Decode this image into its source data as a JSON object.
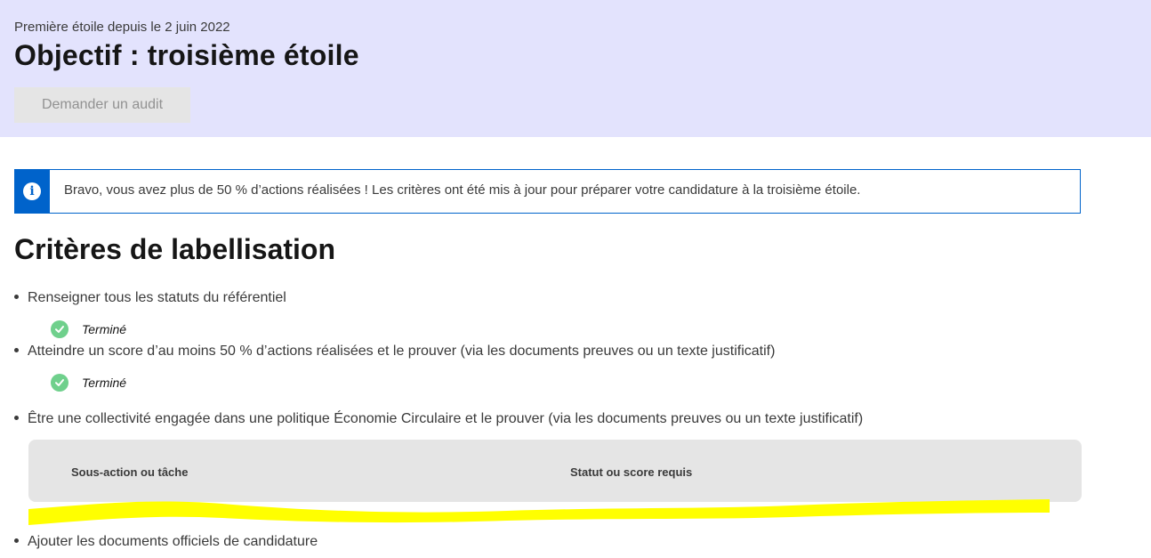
{
  "header": {
    "subtitle": "Première étoile depuis le 2 juin 2022",
    "title": "Objectif : troisième étoile",
    "audit_button_label": "Demander un audit",
    "background_color": "#e3e3fd"
  },
  "alert": {
    "icon": "info-icon",
    "icon_glyph": "i",
    "message": "Bravo, vous avez plus de 50 % d’actions réalisées ! Les critères ont été mis à jour pour préparer votre candidature à la troisième étoile.",
    "accent_color": "#0063cb"
  },
  "criteria_section": {
    "title": "Critères de labellisation",
    "items": [
      {
        "label": "Renseigner tous les statuts du référentiel",
        "status": "Terminé",
        "status_icon": "check-circle-icon"
      },
      {
        "label": "Atteindre un score d’au moins 50 % d’actions réalisées et le prouver (via les documents preuves ou un texte justificatif)",
        "status": "Terminé",
        "status_icon": "check-circle-icon"
      },
      {
        "label": "Être une collectivité engagée dans une politique Économie Circulaire et le prouver (via les documents preuves ou un texte justificatif)"
      },
      {
        "label": "Ajouter les documents officiels de candidature"
      }
    ],
    "table": {
      "columns": [
        "Sous-action ou tâche",
        "Statut ou score requis"
      ]
    },
    "status_color": "#6fd08c",
    "highlight_color": "#ffff00"
  }
}
